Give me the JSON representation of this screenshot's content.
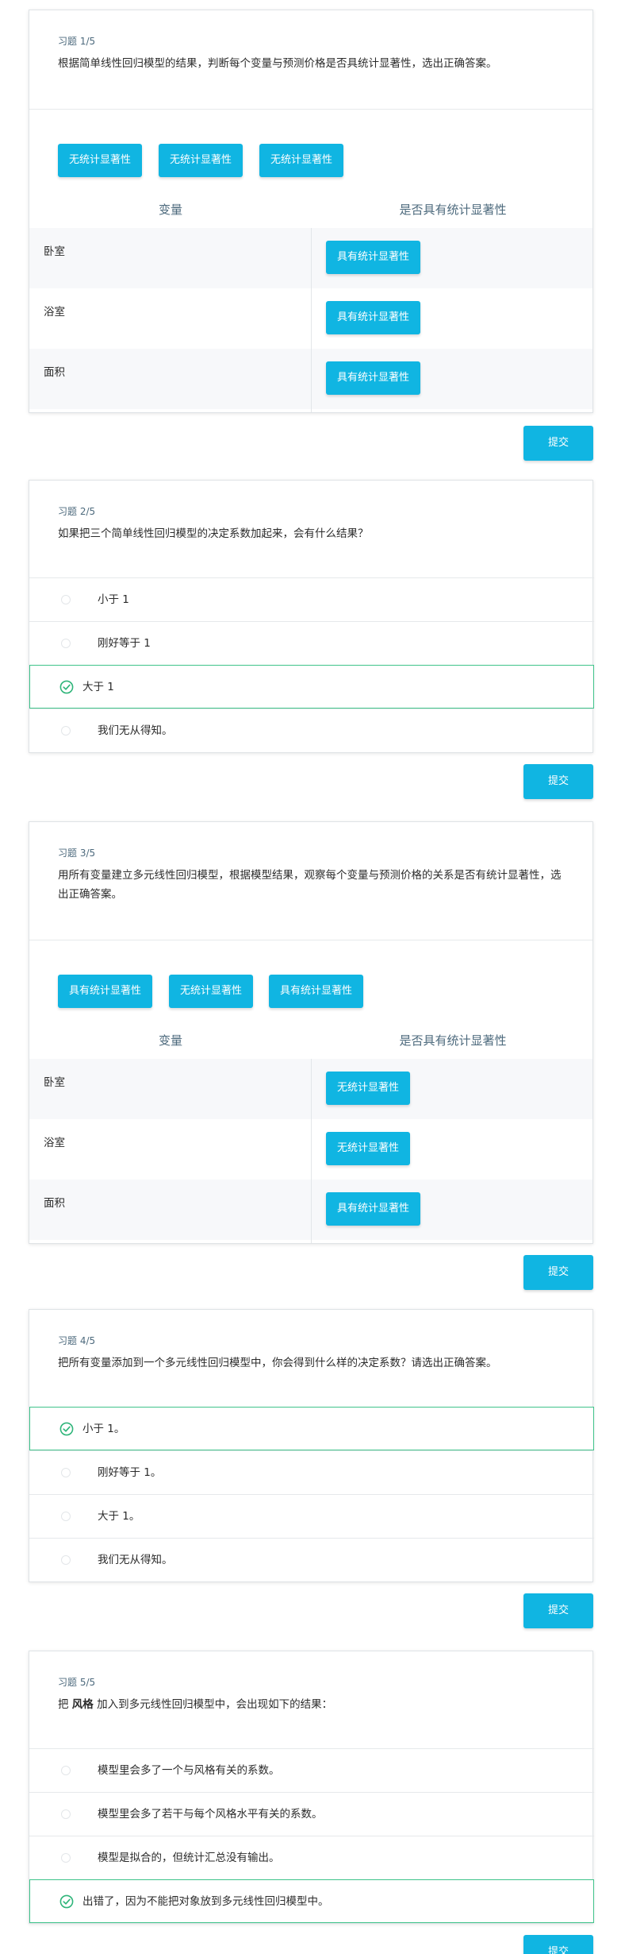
{
  "submit_label": "提交",
  "col_variable": "变量",
  "col_significance": "是否具有统计显著性",
  "q1": {
    "label": "习题 1/5",
    "text": "根据简单线性回归模型的结果，判断每个变量与预测价格是否具统计显著性，选出正确答案。",
    "pool": [
      "无统计显著性",
      "无统计显著性",
      "无统计显著性"
    ],
    "rows": [
      {
        "variable": "卧室",
        "answer": "具有统计显著性"
      },
      {
        "variable": "浴室",
        "answer": "具有统计显著性"
      },
      {
        "variable": "面积",
        "answer": "具有统计显著性"
      }
    ]
  },
  "q2": {
    "label": "习题 2/5",
    "text": "如果把三个简单线性回归模型的决定系数加起来，会有什么结果？",
    "options": [
      "小于 1",
      "刚好等于 1",
      "大于 1",
      "我们无从得知。"
    ],
    "correct_index": 2
  },
  "q3": {
    "label": "习题 3/5",
    "text": "用所有变量建立多元线性回归模型，根据模型结果，观察每个变量与预测价格的关系是否有统计显著性，选出正确答案。",
    "pool": [
      "具有统计显著性",
      "无统计显著性",
      "具有统计显著性"
    ],
    "rows": [
      {
        "variable": "卧室",
        "answer": "无统计显著性"
      },
      {
        "variable": "浴室",
        "answer": "无统计显著性"
      },
      {
        "variable": "面积",
        "answer": "具有统计显著性"
      }
    ]
  },
  "q4": {
    "label": "习题 4/5",
    "text": "把所有变量添加到一个多元线性回归模型中，你会得到什么样的决定系数？请选出正确答案。",
    "options": [
      "小于 1。",
      "刚好等于 1。",
      "大于 1。",
      "我们无从得知。"
    ],
    "correct_index": 0
  },
  "q5": {
    "label": "习题 5/5",
    "text_prefix": "把 ",
    "text_bold": "风格",
    "text_suffix": " 加入到多元线性回归模型中，会出现如下的结果：",
    "options": [
      "模型里会多了一个与风格有关的系数。",
      "模型里会多了若干与每个风格水平有关的系数。",
      "模型是拟合的，但统计汇总没有输出。",
      "出错了，因为不能把对象放到多元线性回归模型中。"
    ],
    "correct_index": 3
  }
}
